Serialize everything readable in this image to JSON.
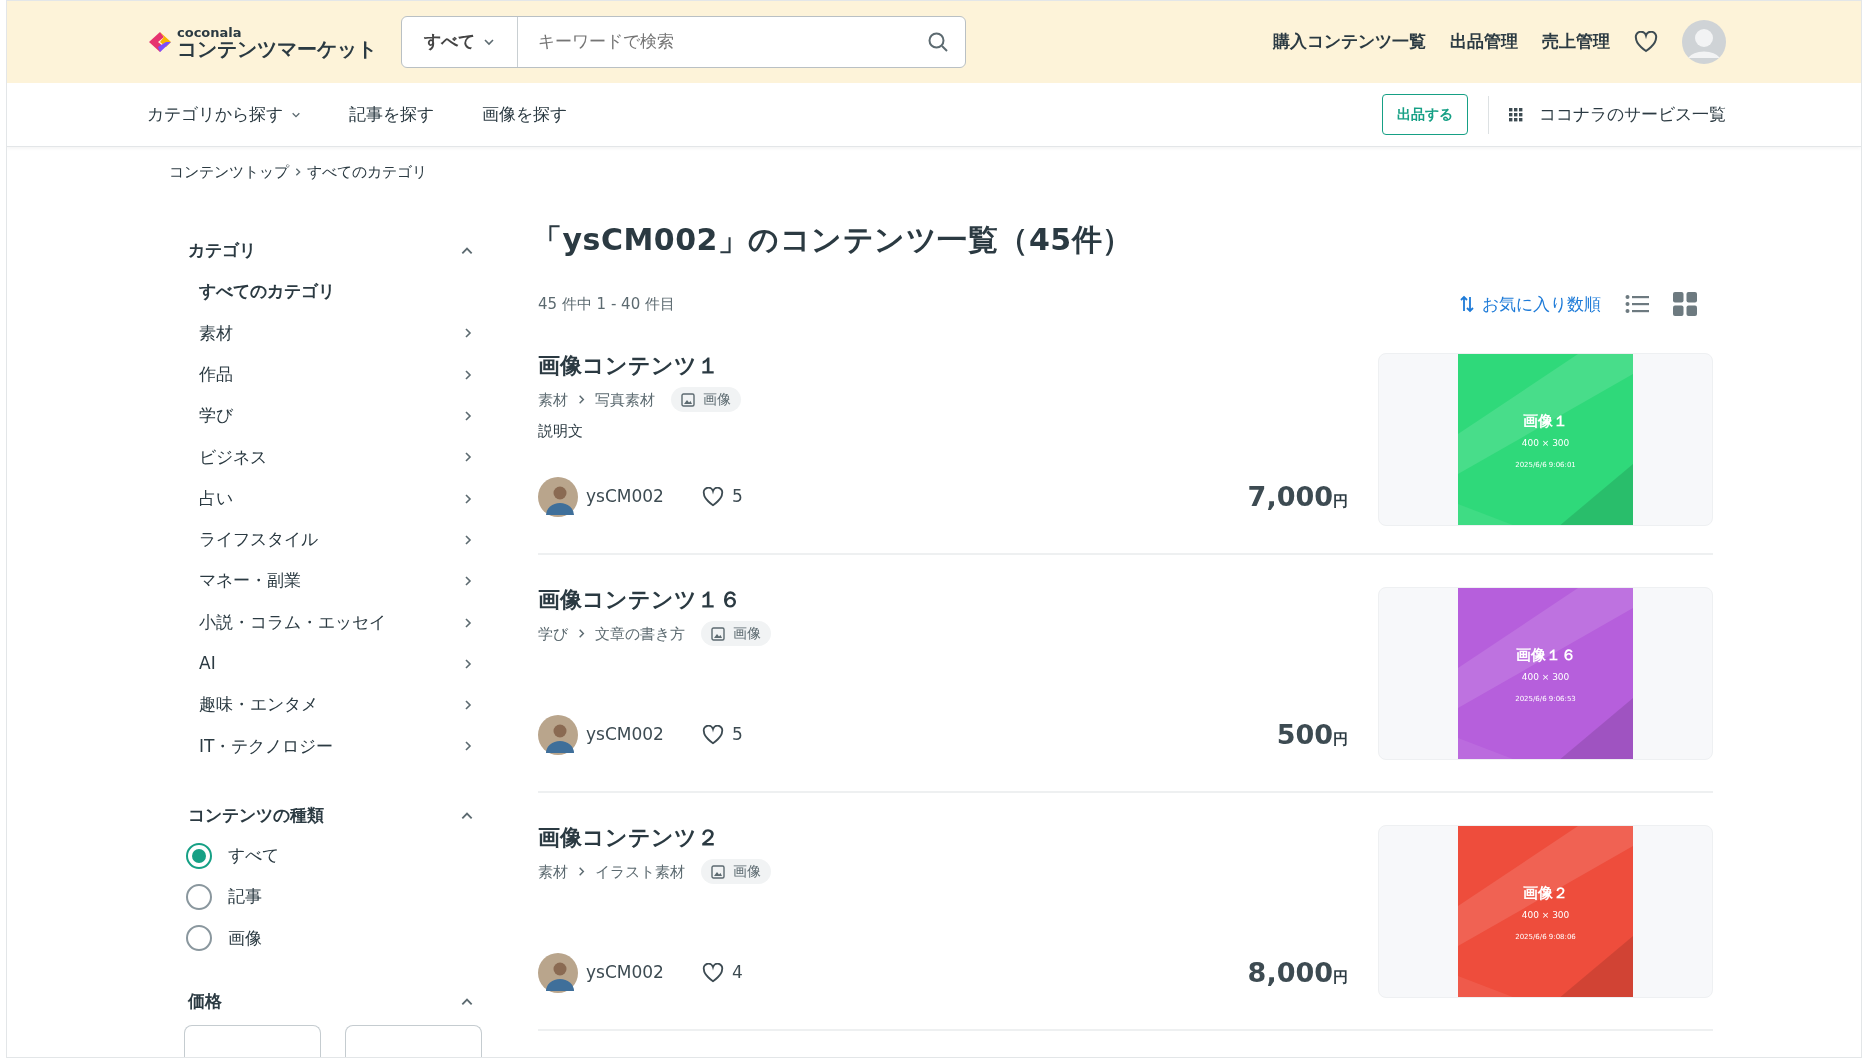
{
  "header": {
    "logo": {
      "small": "coconala",
      "main": "コンテンツマーケット"
    },
    "search": {
      "scope": "すべて",
      "placeholder": "キーワードで検索"
    },
    "links": [
      "購入コンテンツ一覧",
      "出品管理",
      "売上管理"
    ]
  },
  "nav": {
    "items": [
      {
        "label": "カテゴリから探す",
        "kind": "dropdown"
      },
      {
        "label": "記事を探す",
        "kind": "link"
      },
      {
        "label": "画像を探す",
        "kind": "link"
      }
    ],
    "post_button": "出品する",
    "services": "ココナラのサービス一覧"
  },
  "breadcrumb": [
    "コンテンツトップ",
    "すべてのカテゴリ"
  ],
  "sidebar": {
    "category": {
      "title": "カテゴリ",
      "expanded": true,
      "items": [
        {
          "label": "すべてのカテゴリ",
          "selected": true
        },
        {
          "label": "素材",
          "selected": false
        },
        {
          "label": "作品",
          "selected": false
        },
        {
          "label": "学び",
          "selected": false
        },
        {
          "label": "ビジネス",
          "selected": false
        },
        {
          "label": "占い",
          "selected": false
        },
        {
          "label": "ライフスタイル",
          "selected": false
        },
        {
          "label": "マネー・副業",
          "selected": false
        },
        {
          "label": "小説・コラム・エッセイ",
          "selected": false
        },
        {
          "label": "AI",
          "selected": false
        },
        {
          "label": "趣味・エンタメ",
          "selected": false
        },
        {
          "label": "IT・テクノロジー",
          "selected": false
        }
      ]
    },
    "content_type": {
      "title": "コンテンツの種類",
      "expanded": true,
      "options": [
        {
          "label": "すべて",
          "selected": true
        },
        {
          "label": "記事",
          "selected": false
        },
        {
          "label": "画像",
          "selected": false
        }
      ]
    },
    "price": {
      "title": "価格",
      "expanded": true
    }
  },
  "main": {
    "title": "「ysCM002」のコンテンツ一覧（45件）",
    "count": "45 件中 1 - 40 件目",
    "sort": "お気に入り数順",
    "items": [
      {
        "title": "画像コンテンツ１",
        "category": "素材",
        "subcategory": "写真素材",
        "type": "画像",
        "description": "説明文",
        "author": "ysCM002",
        "likes": "5",
        "price": "7,000",
        "currency": "円",
        "thumbnail": {
          "color": "#2fd97a",
          "title": "画像１",
          "size": "400 × 300",
          "date": "2025/6/6 9:06:01"
        }
      },
      {
        "title": "画像コンテンツ１６",
        "category": "学び",
        "subcategory": "文章の書き方",
        "type": "画像",
        "author": "ysCM002",
        "likes": "5",
        "price": "500",
        "currency": "円",
        "thumbnail": {
          "color": "#b65fdc",
          "title": "画像１６",
          "size": "400 × 300",
          "date": "2025/6/6 9:06:53"
        }
      },
      {
        "title": "画像コンテンツ２",
        "category": "素材",
        "subcategory": "イラスト素材",
        "type": "画像",
        "author": "ysCM002",
        "likes": "4",
        "price": "8,000",
        "currency": "円",
        "thumbnail": {
          "color": "#ee4d3c",
          "title": "画像２",
          "size": "400 × 300",
          "date": "2025/6/6 9:08:06"
        }
      }
    ]
  }
}
